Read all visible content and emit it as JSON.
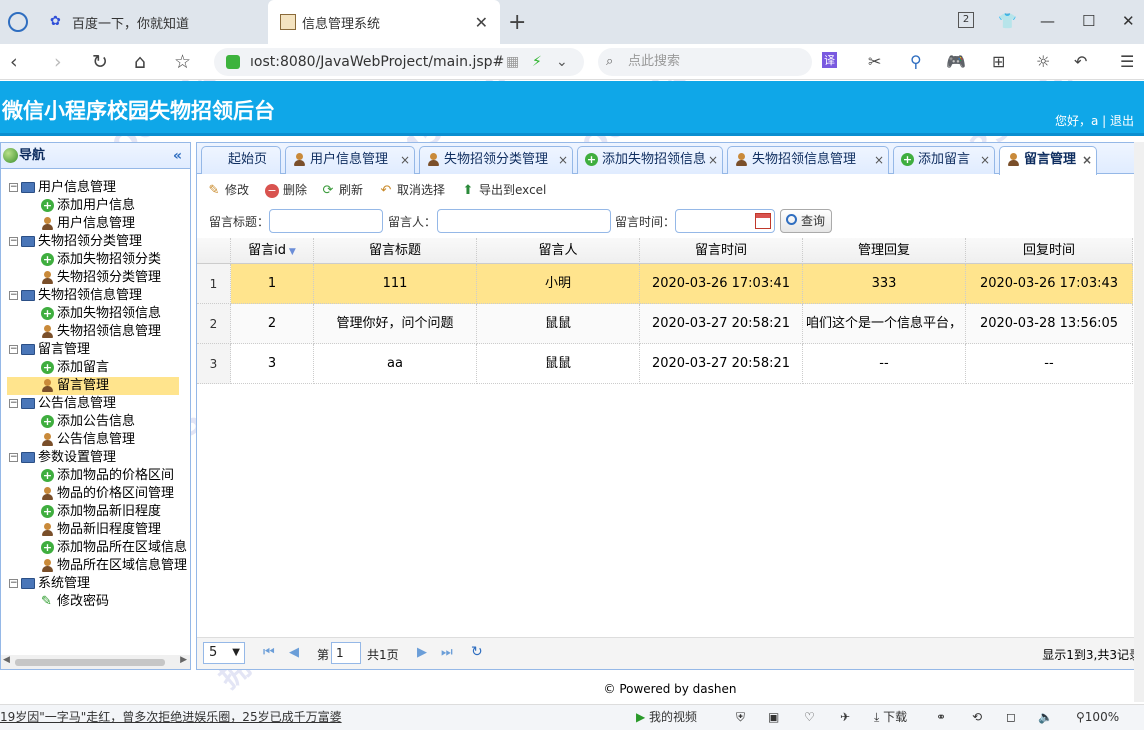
{
  "browser": {
    "tabs": [
      {
        "title": "百度一下，你就知道"
      },
      {
        "title": "信息管理系统"
      }
    ],
    "tab_count": "2",
    "url": "ıost:8080/JavaWebProject/main.jsp#",
    "search_placeholder": "点此搜索"
  },
  "app": {
    "title": "微信小程序校园失物招领后台",
    "greeting": "您好，a | 退出"
  },
  "nav": {
    "title": "导航",
    "collapse_icon": "«",
    "groups": [
      {
        "label": "用户信息管理",
        "items": [
          "添加用户信息",
          "用户信息管理"
        ]
      },
      {
        "label": "失物招领分类管理",
        "items": [
          "添加失物招领分类",
          "失物招领分类管理"
        ]
      },
      {
        "label": "失物招领信息管理",
        "items": [
          "添加失物招领信息",
          "失物招领信息管理"
        ]
      },
      {
        "label": "留言管理",
        "items": [
          "添加留言",
          "留言管理"
        ]
      },
      {
        "label": "公告信息管理",
        "items": [
          "添加公告信息",
          "公告信息管理"
        ]
      },
      {
        "label": "参数设置管理",
        "items": [
          "添加物品的价格区间",
          "物品的价格区间管理",
          "添加物品新旧程度",
          "物品新旧程度管理",
          "添加物品所在区域信息",
          "物品所在区域信息管理"
        ]
      },
      {
        "label": "系统管理",
        "items": [
          "修改密码"
        ]
      }
    ],
    "selected": "留言管理"
  },
  "tabs": [
    {
      "label": "起始页",
      "closable": false
    },
    {
      "label": "用户信息管理",
      "closable": true
    },
    {
      "label": "失物招领分类管理",
      "closable": true
    },
    {
      "label": "添加失物招领信息",
      "closable": true
    },
    {
      "label": "失物招领信息管理",
      "closable": true
    },
    {
      "label": "添加留言",
      "closable": true
    },
    {
      "label": "留言管理",
      "closable": true
    }
  ],
  "toolbar": {
    "edit": "修改",
    "delete": "删除",
    "refresh": "刷新",
    "deselect": "取消选择",
    "export": "导出到excel"
  },
  "search": {
    "title_label": "留言标题：",
    "author_label": "留言人：",
    "time_label": "留言时间：",
    "query_button": "查询"
  },
  "grid": {
    "columns": [
      "留言id",
      "留言标题",
      "留言人",
      "留言时间",
      "管理回复",
      "回复时间"
    ],
    "rows": [
      {
        "num": "1",
        "cells": [
          "1",
          "111",
          "小明",
          "2020-03-26 17:03:41",
          "333",
          "2020-03-26 17:03:43"
        ]
      },
      {
        "num": "2",
        "cells": [
          "2",
          "管理你好，问个问题",
          "鼠鼠",
          "2020-03-27 20:58:21",
          "咱们这个是一个信息平台，",
          "2020-03-28 13:56:05"
        ]
      },
      {
        "num": "3",
        "cells": [
          "3",
          "aa",
          "鼠鼠",
          "2020-03-27 20:58:21",
          "--",
          "--"
        ]
      }
    ],
    "selected_row": 0
  },
  "pager": {
    "page_size": "5",
    "page_label": "第",
    "page_value": "1",
    "total_pages": "共1页",
    "info": "显示1到3,共3记录"
  },
  "footer": "© Powered by dashen",
  "statusbar": {
    "news": "19岁因\"一字马\"走红，曾多次拒绝进娱乐圈，25岁已成千万富婆",
    "my_video": "我的视频",
    "download": "下载",
    "zoom": "100%"
  },
  "watermarks": [
    "QQ:25454045",
    "大神计算机设计",
    "拥有海量源码"
  ],
  "colors": {
    "header": "#0fa7e8",
    "selected_row": "#ffe48d",
    "panel_border": "#95b8e7"
  }
}
